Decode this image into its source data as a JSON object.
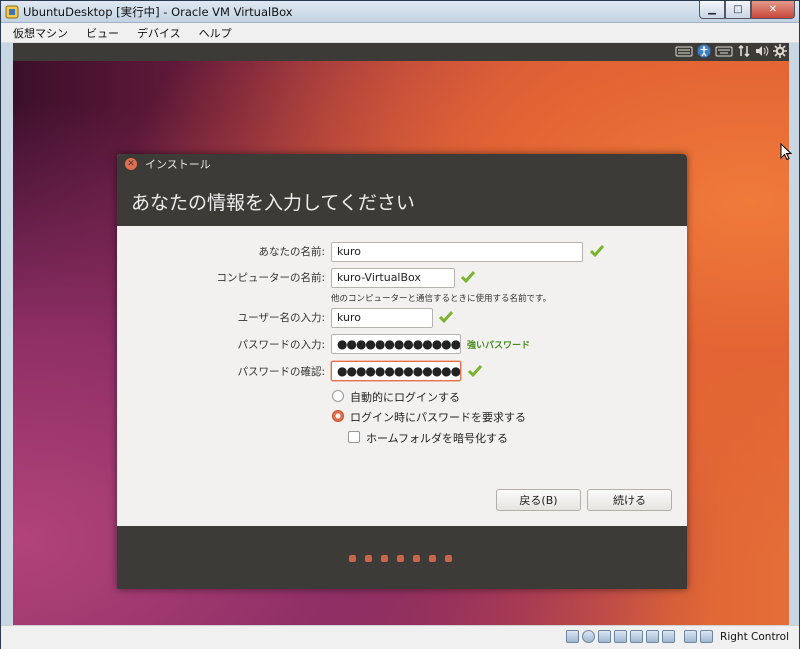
{
  "window": {
    "title": "UbuntuDesktop [実行中] - Oracle VM VirtualBox",
    "minimize": "▁",
    "maximize": "□",
    "close": "✕"
  },
  "menu": [
    "仮想マシン",
    "ビュー",
    "デバイス",
    "ヘルプ"
  ],
  "guest_panel": {
    "icons": [
      "keyboard-icon",
      "accessibility-icon",
      "keyboard-layout-icon",
      "network-icon",
      "volume-icon",
      "settings-gear-icon"
    ]
  },
  "dialog": {
    "title": "インストール",
    "heading": "あなたの情報を入力してください",
    "fields": {
      "name_label": "あなたの名前:",
      "name_value": "kuro",
      "computer_label": "コンピューターの名前:",
      "computer_value": "kuro-VirtualBox",
      "computer_hint": "他のコンピューターと通信するときに使用する名前です。",
      "user_label": "ユーザー名の入力:",
      "user_value": "kuro",
      "password_label": "パスワードの入力:",
      "password_value": "●●●●●●●●●●●●●●",
      "password_strength": "強いパスワード",
      "confirm_label": "パスワードの確認:",
      "confirm_value": "●●●●●●●●●●●●●●"
    },
    "options": {
      "auto_login": "自動的にログインする",
      "require_password": "ログイン時にパスワードを要求する",
      "encrypt_home": "ホームフォルダを暗号化する"
    },
    "buttons": {
      "back": "戻る(B)",
      "continue": "続ける"
    },
    "progress_steps": 7
  },
  "status": {
    "host_key": "Right Control"
  },
  "colors": {
    "accent": "#e36e4f",
    "panel": "#3c3b37",
    "ok_green": "#4a8b1f"
  }
}
